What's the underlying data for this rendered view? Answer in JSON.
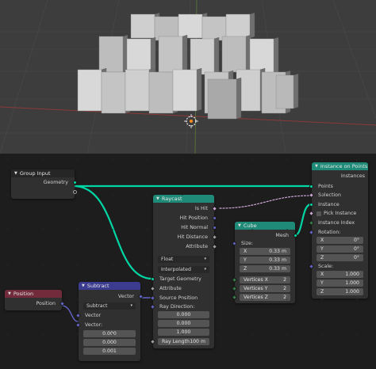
{
  "colors": {
    "geometry_socket": "#00d6a3",
    "boolean_socket": "#cca6d6",
    "vector_socket": "#6363c7",
    "float_socket": "#a1a1a1",
    "geo_header": "#1f8a78",
    "input_header": "#722b3a",
    "vector_header": "#3b3b8f",
    "group_header": "#262626"
  },
  "nodes": {
    "group_input": {
      "title": "Group Input",
      "geometry": "Geometry"
    },
    "raycast": {
      "title": "Raycast",
      "outputs": [
        "Is Hit",
        "Hit Position",
        "Hit Normal",
        "Hit Distance",
        "Attribute"
      ],
      "data_type": "Float",
      "mapping": "Interpolated",
      "inputs": [
        "Target Geometry",
        "Attribute",
        "Source Position",
        "Ray Direction:"
      ],
      "ray_direction": [
        "0.000",
        "0.000",
        "1.000"
      ],
      "ray_length_label": "Ray Length",
      "ray_length_value": "100 m"
    },
    "cube": {
      "title": "Cube",
      "output": "Mesh",
      "size_label": "Size:",
      "size": [
        {
          "axis": "X",
          "value": "0.33 m"
        },
        {
          "axis": "Y",
          "value": "0.33 m"
        },
        {
          "axis": "Z",
          "value": "0.33 m"
        }
      ],
      "vertices": [
        {
          "label": "Vertices X",
          "value": "2"
        },
        {
          "label": "Vertices Y",
          "value": "2"
        },
        {
          "label": "Vertices Z",
          "value": "2"
        }
      ]
    },
    "instance_on_points": {
      "title": "Instance on Points",
      "output": "Instances",
      "inputs": [
        "Points",
        "Selection",
        "Instance"
      ],
      "pick_instance": "Pick Instance",
      "instance_index": "Instance Index",
      "rotation_label": "Rotation:",
      "rotation": [
        {
          "axis": "X",
          "value": "0°"
        },
        {
          "axis": "Y",
          "value": "0°"
        },
        {
          "axis": "Z",
          "value": "0°"
        }
      ],
      "scale_label": "Scale:",
      "scale": [
        {
          "axis": "X",
          "value": "1.000"
        },
        {
          "axis": "Y",
          "value": "1.000"
        },
        {
          "axis": "Z",
          "value": "1.000"
        }
      ]
    },
    "position": {
      "title": "Position",
      "output": "Position"
    },
    "subtract": {
      "title": "Subtract",
      "output": "Vector",
      "operation": "Subtract",
      "inputs": [
        "Vector",
        "Vector:"
      ],
      "values": [
        "0.000",
        "0.000",
        "0.001"
      ]
    }
  }
}
